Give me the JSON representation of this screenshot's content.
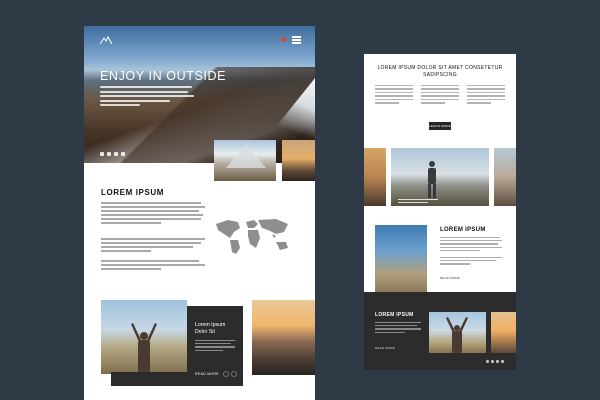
{
  "large_page": {
    "hero": {
      "title": "ENJOY IN OUTSIDE",
      "social_icons": [
        "facebook-icon",
        "twitter-icon",
        "instagram-icon",
        "twitter-bird-icon"
      ]
    },
    "section": {
      "title": "LOREM IPSUM"
    },
    "card": {
      "title": "Lorem Ipsum Dolor Sit",
      "read_more": "READ MORE"
    }
  },
  "small_page": {
    "title": "LOREM IPSUM DOLOR SIT AMET CONSETETUR SADIPSCING",
    "button": "LEARN MORE",
    "feature": {
      "title": "LOREM IPSUM",
      "read_more": "READ MORE"
    },
    "footer": {
      "title": "LOREM IPSUM",
      "read_more": "READ MORE"
    }
  },
  "colors": {
    "background": "#2e3b47",
    "dark_panel": "#2c2c2c",
    "page": "#ffffff"
  }
}
